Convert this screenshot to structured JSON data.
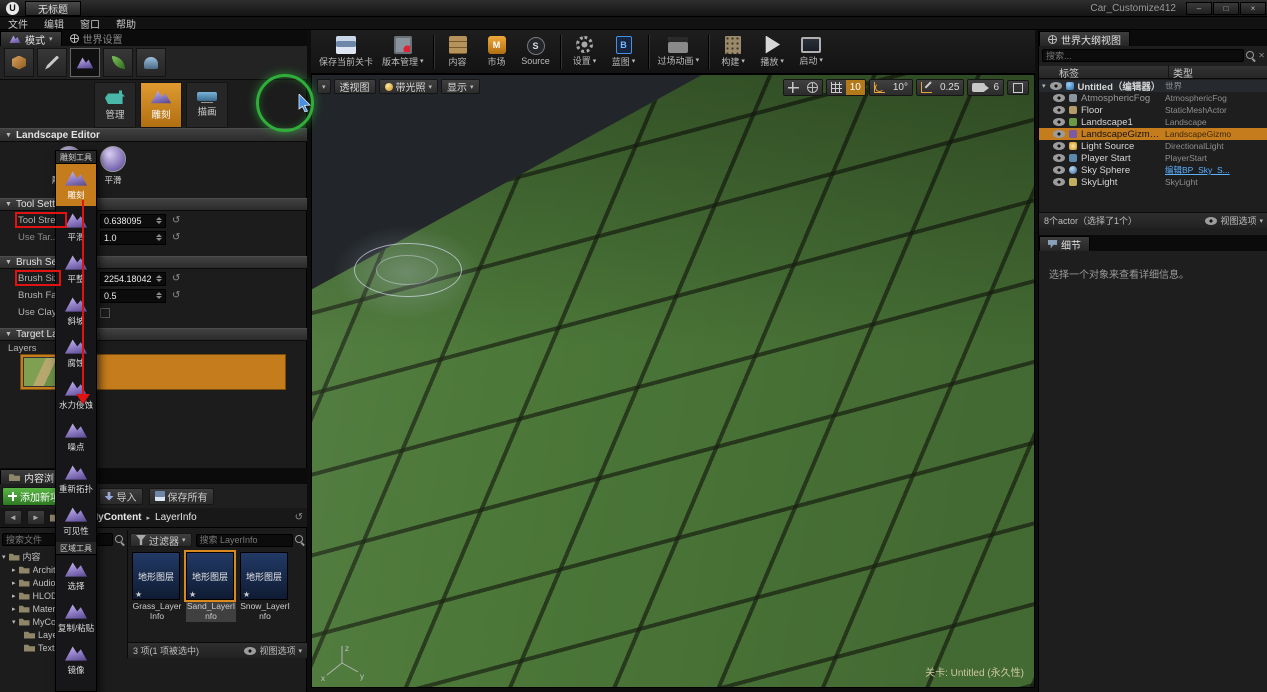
{
  "window": {
    "logo": "U",
    "doc_tab": "无标题",
    "project": "Car_Customize412",
    "min": "–",
    "restore": "□",
    "close": "×"
  },
  "menu": {
    "items": [
      "文件",
      "编辑",
      "窗口",
      "帮助"
    ]
  },
  "colors": {
    "accent_orange": "#c57c1c",
    "annotation_red": "#e01212",
    "annotation_green": "#2fae3a",
    "link_blue": "#5ab1ff",
    "grass_green": "#4c7839"
  },
  "modes": {
    "tab_modes": "模式",
    "tab_world": "世界设置",
    "buttons": [
      {
        "label": "管理"
      },
      {
        "label": "雕刻"
      },
      {
        "label": "描画"
      }
    ],
    "editor_header": "Landscape Editor",
    "current_tool_label": "雕刻工具",
    "smooth_label": "平滑",
    "tool_settings_header": "Tool Settings",
    "brush_settings_header": "Brush Settings",
    "target_layers_header": "Target Layers",
    "layers_label": "Layers",
    "rows": {
      "tool_strength": {
        "label": "Tool Strength",
        "value": "0.638095"
      },
      "use_target": {
        "label": "Use Tar...",
        "value": "1.0"
      },
      "brush_size": {
        "label": "Brush Size",
        "value": "2254.18042"
      },
      "brush_falloff": {
        "label": "Brush Falloff",
        "value": "0.5"
      },
      "use_clay": {
        "label": "Use Clay Br..."
      }
    }
  },
  "tool_dropdown": {
    "header": "雕刻工具",
    "items": [
      "雕刻",
      "平滑",
      "平整",
      "斜坡",
      "腐蚀",
      "水力侵蚀",
      "噪点",
      "重新拓扑",
      "可见性"
    ],
    "region_header": "区域工具",
    "region_items": [
      "选择",
      "复制/粘贴",
      "镜像"
    ],
    "selected": "雕刻"
  },
  "toolbar": {
    "items": [
      {
        "label": "保存当前关卡"
      },
      {
        "label": "版本管理",
        "dd": "▾"
      },
      {
        "label": "内容"
      },
      {
        "label": "市场"
      },
      {
        "label": "Source"
      },
      {
        "label": "设置",
        "dd": "▾"
      },
      {
        "label": "蓝图",
        "dd": "▾"
      },
      {
        "label": "过场动画",
        "dd": "▾"
      },
      {
        "label": "构建",
        "dd": "▾"
      },
      {
        "label": "播放",
        "dd": "▾"
      },
      {
        "label": "启动",
        "dd": "▾"
      }
    ]
  },
  "viewport": {
    "perspective": "透视图",
    "lit": "带光照",
    "show": "显示",
    "grid_snap": "10",
    "angle_snap": "10°",
    "scale_snap": "0.25",
    "camera_speed": "6",
    "level_status": "关卡: Untitled (永久性)",
    "axis_x": "x",
    "axis_y": "y",
    "axis_z": "z"
  },
  "outliner": {
    "tab": "世界大纲视图",
    "search_placeholder": "搜索...",
    "col_label": "标签",
    "col_type": "类型",
    "rows": [
      {
        "label": "Untitled（编辑器）",
        "type": "世界"
      },
      {
        "label": "AtmosphericFog",
        "type": "AtmosphericFog"
      },
      {
        "label": "Floor",
        "type": "StaticMeshActor"
      },
      {
        "label": "Landscape1",
        "type": "Landscape"
      },
      {
        "label": "LandscapeGizmoActiveActor",
        "type": "LandscapeGizmo"
      },
      {
        "label": "Light Source",
        "type": "DirectionalLight"
      },
      {
        "label": "Player Start",
        "type": "PlayerStart"
      },
      {
        "label": "Sky Sphere",
        "type": "编辑BP_Sky_S..."
      },
      {
        "label": "SkyLight",
        "type": "SkyLight"
      }
    ],
    "footer": "8个actor（选择了1个）",
    "view_options": "视图选项"
  },
  "details": {
    "tab": "细节",
    "empty_message": "选择一个对象来查看详细信息。"
  },
  "content_browser": {
    "tab": "内容浏览器",
    "add_new": "添加新项",
    "import": "导入",
    "save_all": "保存所有",
    "crumb_root": "MyContent",
    "crumb_sep": "▸",
    "crumb_current": "LayerInfo",
    "filters": "过滤器",
    "search_placeholder": "搜索 LayerInfo",
    "assets": [
      {
        "thumb_label": "地形图层",
        "name": "Grass_LayerInfo"
      },
      {
        "thumb_label": "地形图层",
        "name": "Sand_LayerInfo"
      },
      {
        "thumb_label": "地形图层",
        "name": "Snow_LayerInfo"
      }
    ],
    "status": "3 项(1 项被选中)",
    "view_options": "视图选项"
  },
  "sources": {
    "search_placeholder": "搜索文件",
    "tree": [
      {
        "label": "内容"
      },
      {
        "label": "Archit..."
      },
      {
        "label": "Audio"
      },
      {
        "label": "HLOD..."
      },
      {
        "label": "Mater..."
      },
      {
        "label": "MyCo..."
      },
      {
        "label": "Layer..."
      },
      {
        "label": "Textur..."
      }
    ]
  }
}
